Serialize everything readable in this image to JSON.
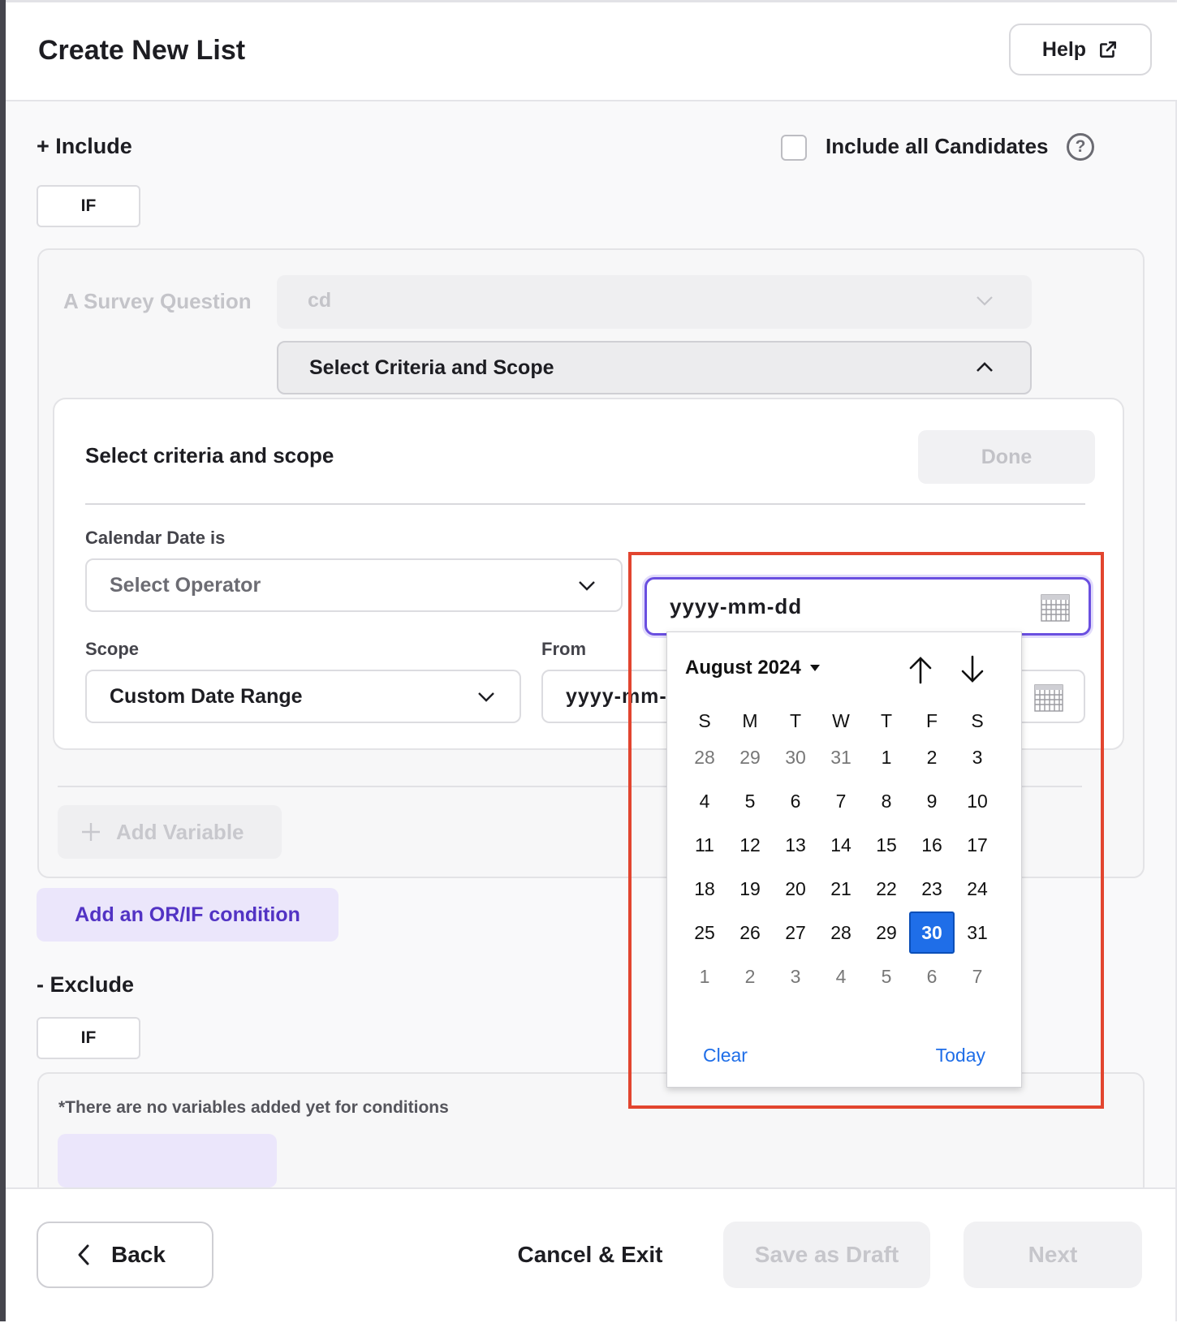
{
  "header": {
    "title": "Create New List",
    "help_label": "Help"
  },
  "include": {
    "title": "+ Include",
    "include_all_label": "Include all Candidates",
    "if_label": "IF",
    "question_label": "A Survey Question",
    "question_value": "cd",
    "criteria_toggle_label": "Select Criteria and Scope"
  },
  "criteria": {
    "title": "Select criteria and scope",
    "done_label": "Done",
    "calendar_date_label": "Calendar Date is",
    "operator_placeholder": "Select Operator",
    "date_placeholder": "yyyy-mm-dd",
    "scope_label": "Scope",
    "scope_value": "Custom Date Range",
    "from_label": "From",
    "from_placeholder": "yyyy-mm-dd"
  },
  "actions": {
    "add_variable_label": "Add Variable",
    "add_or_if_label": "Add an OR/IF condition"
  },
  "exclude": {
    "title": "- Exclude",
    "if_label": "IF",
    "empty_note": "*There are no variables added yet for conditions"
  },
  "footer": {
    "back_label": "Back",
    "cancel_label": "Cancel & Exit",
    "draft_label": "Save as Draft",
    "next_label": "Next"
  },
  "calendar": {
    "month_label": "August 2024",
    "weekdays": [
      "S",
      "M",
      "T",
      "W",
      "T",
      "F",
      "S"
    ],
    "weeks": [
      [
        "28",
        "29",
        "30",
        "31",
        "1",
        "2",
        "3"
      ],
      [
        "4",
        "5",
        "6",
        "7",
        "8",
        "9",
        "10"
      ],
      [
        "11",
        "12",
        "13",
        "14",
        "15",
        "16",
        "17"
      ],
      [
        "18",
        "19",
        "20",
        "21",
        "22",
        "23",
        "24"
      ],
      [
        "25",
        "26",
        "27",
        "28",
        "29",
        "30",
        "31"
      ],
      [
        "1",
        "2",
        "3",
        "4",
        "5",
        "6",
        "7"
      ]
    ],
    "muted_days": [
      [
        0,
        0
      ],
      [
        0,
        1
      ],
      [
        0,
        2
      ],
      [
        0,
        3
      ],
      [
        5,
        0
      ],
      [
        5,
        1
      ],
      [
        5,
        2
      ],
      [
        5,
        3
      ],
      [
        5,
        4
      ],
      [
        5,
        5
      ],
      [
        5,
        6
      ]
    ],
    "selected_day": [
      4,
      5
    ],
    "clear_label": "Clear",
    "today_label": "Today"
  },
  "colors": {
    "accent": "#6a4fe0",
    "selected_day": "#1f6ee8",
    "highlight": "#e2452f",
    "link": "#1f6ee8"
  }
}
